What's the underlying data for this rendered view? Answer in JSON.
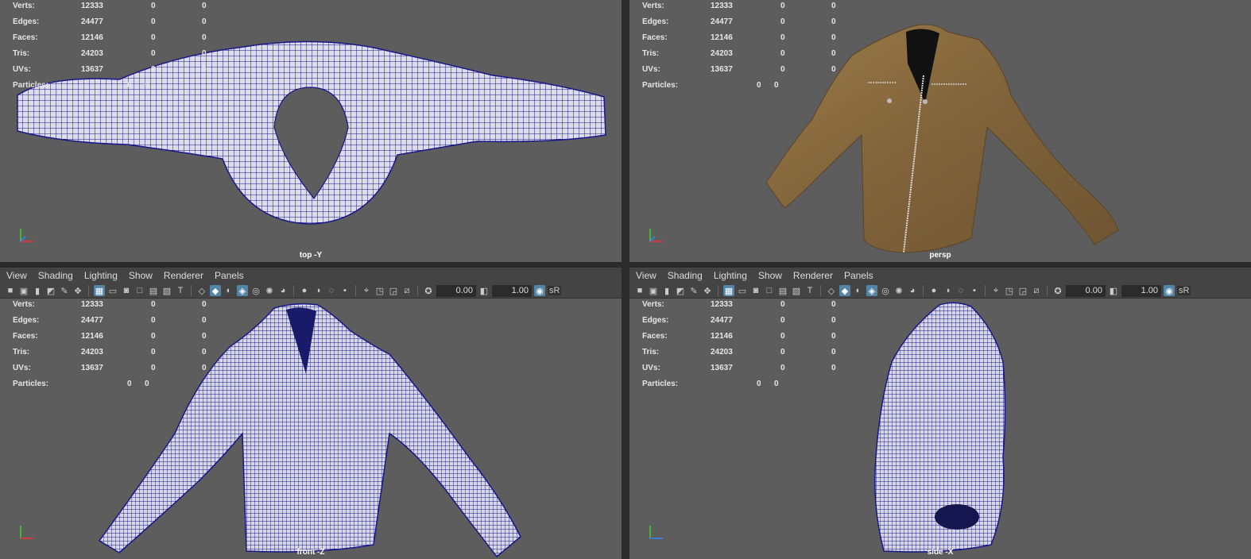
{
  "menu": {
    "items": [
      "View",
      "Shading",
      "Lighting",
      "Show",
      "Renderer",
      "Panels"
    ]
  },
  "toolbar": {
    "exposure": "0.00",
    "gamma": "1.00",
    "color_space": "sR"
  },
  "stats": {
    "rows": [
      {
        "label": "Verts:",
        "v1": "12333",
        "v2": "0",
        "v3": "0"
      },
      {
        "label": "Edges:",
        "v1": "24477",
        "v2": "0",
        "v3": "0"
      },
      {
        "label": "Faces:",
        "v1": "12146",
        "v2": "0",
        "v3": "0"
      },
      {
        "label": "Tris:",
        "v1": "24203",
        "v2": "0",
        "v3": "0"
      },
      {
        "label": "UVs:",
        "v1": "13637",
        "v2": "0",
        "v3": "0"
      }
    ],
    "particles": {
      "label": "Particles:",
      "v2": "0",
      "v3": "0"
    }
  },
  "viewports": {
    "top": {
      "label": "top -Y"
    },
    "persp": {
      "label": "persp"
    },
    "front": {
      "label": "front -Z"
    },
    "side": {
      "label": "side -X"
    }
  },
  "colors": {
    "viewport_bg": "#5d5d5d",
    "wire": "#1a1a8c",
    "mesh_fill": "#d9d9e6",
    "jacket": "#8a6a3c",
    "active_icon": "#5285a6"
  }
}
